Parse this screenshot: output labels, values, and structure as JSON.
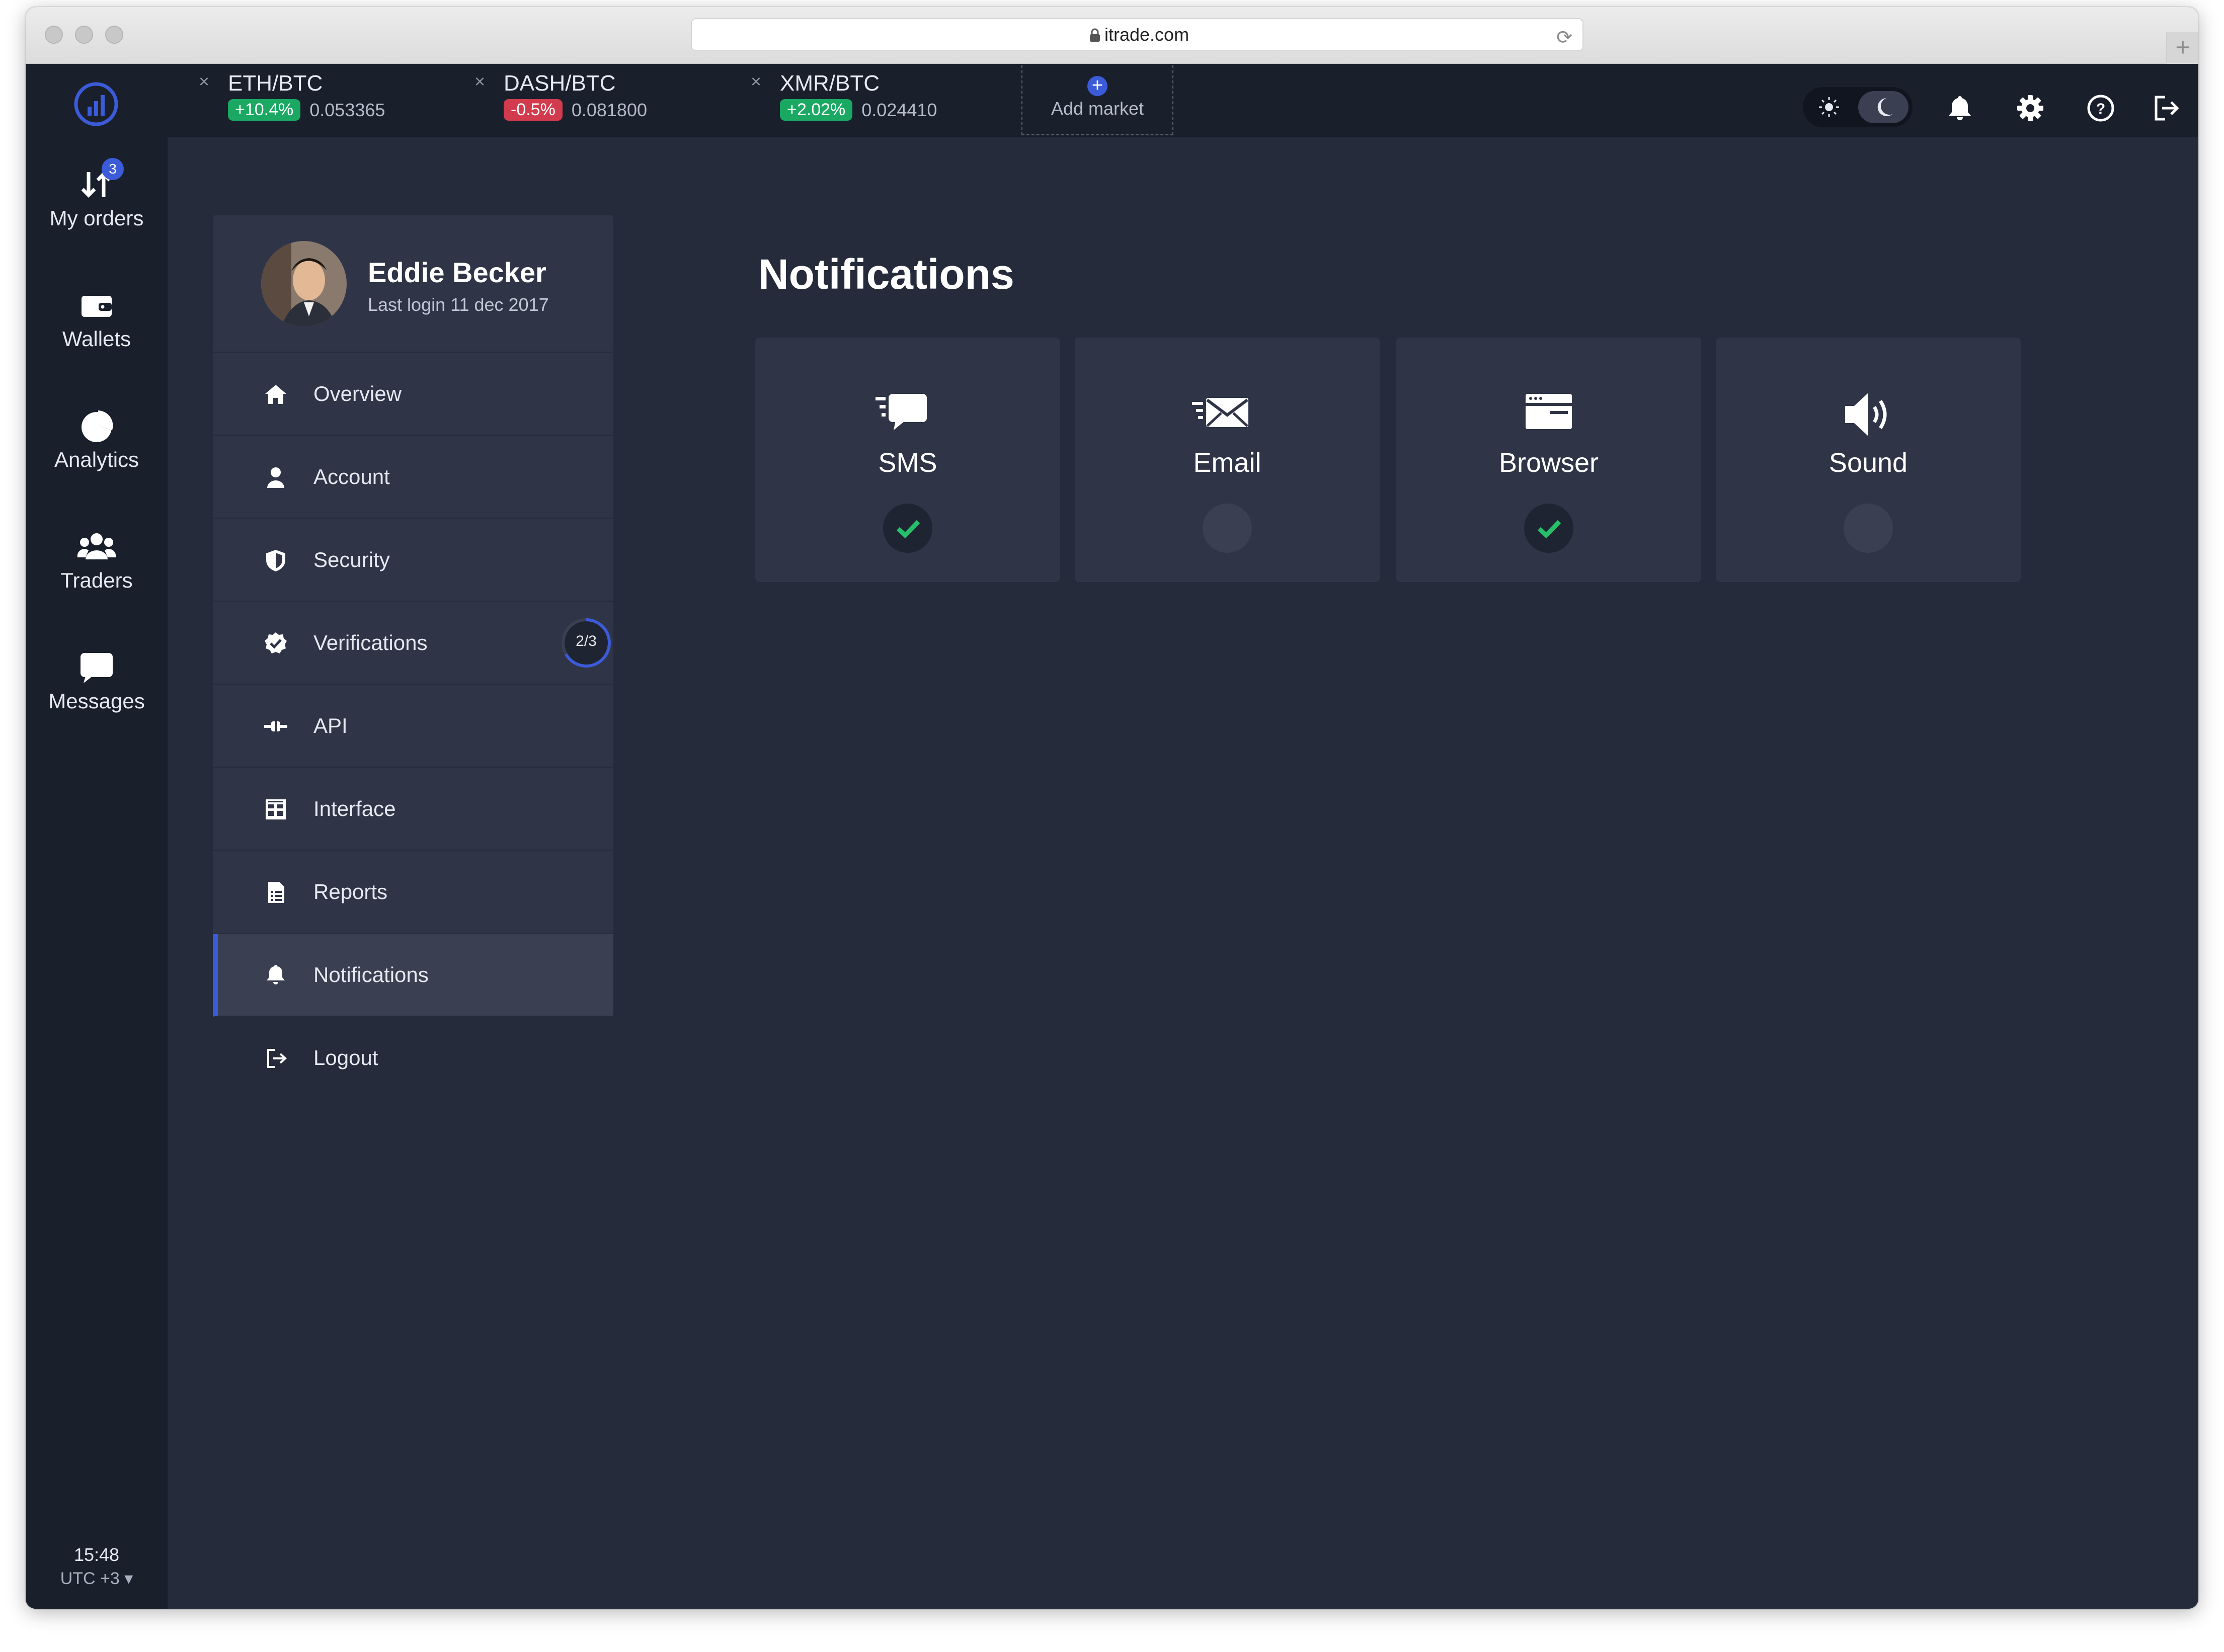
{
  "browser": {
    "url": "itrade.com"
  },
  "sidebar": {
    "items": [
      {
        "label": "My orders",
        "badge": "3",
        "icon": "arrows-up-down-icon"
      },
      {
        "label": "Wallets",
        "icon": "wallet-icon"
      },
      {
        "label": "Analytics",
        "icon": "pie-chart-icon"
      },
      {
        "label": "Traders",
        "icon": "users-icon"
      },
      {
        "label": "Messages",
        "icon": "chat-bubble-icon"
      }
    ],
    "time": "15:48",
    "timezone": "UTC +3 ▾"
  },
  "markets": [
    {
      "pair": "ETH/BTC",
      "change": "+10.4%",
      "price": "0.053365",
      "direction": "up"
    },
    {
      "pair": "DASH/BTC",
      "change": "-0.5%",
      "price": "0.081800",
      "direction": "down"
    },
    {
      "pair": "XMR/BTC",
      "change": "+2.02%",
      "price": "0.024410",
      "direction": "up"
    }
  ],
  "add_market_label": "Add market",
  "theme": {
    "selected": "dark"
  },
  "profile": {
    "name": "Eddie Becker",
    "last_login": "Last login 11 dec 2017"
  },
  "menu": [
    {
      "label": "Overview",
      "icon": "home-icon"
    },
    {
      "label": "Account",
      "icon": "user-icon"
    },
    {
      "label": "Security",
      "icon": "shield-icon"
    },
    {
      "label": "Verifications",
      "icon": "check-badge-icon",
      "progress": "2/3"
    },
    {
      "label": "API",
      "icon": "plug-icon"
    },
    {
      "label": "Interface",
      "icon": "grid-icon"
    },
    {
      "label": "Reports",
      "icon": "document-icon"
    },
    {
      "label": "Notifications",
      "icon": "bell-icon",
      "active": true
    }
  ],
  "logout_label": "Logout",
  "page_title": "Notifications",
  "channels": [
    {
      "label": "SMS",
      "icon": "sms-icon",
      "enabled": true
    },
    {
      "label": "Email",
      "icon": "email-icon",
      "enabled": false
    },
    {
      "label": "Browser",
      "icon": "browser-window-icon",
      "enabled": true
    },
    {
      "label": "Sound",
      "icon": "speaker-icon",
      "enabled": false
    }
  ],
  "colors": {
    "accent": "#3c5bd8",
    "positive": "#1aa863",
    "negative": "#d23b4e",
    "check": "#27c06a"
  }
}
